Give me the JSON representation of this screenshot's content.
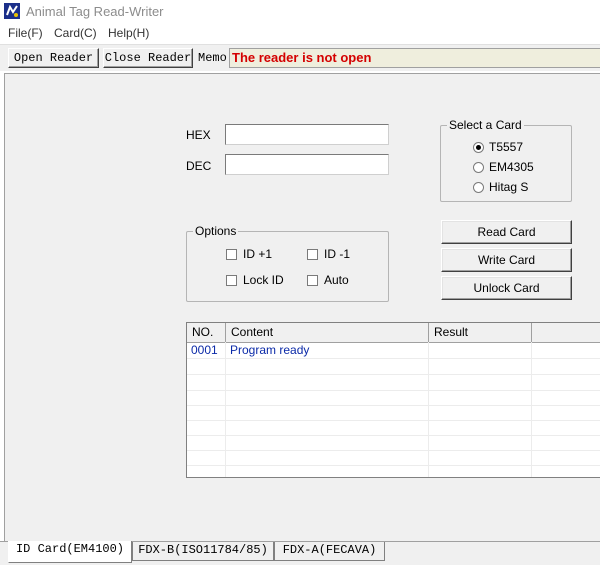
{
  "window": {
    "title": "Animal Tag Read-Writer",
    "icon": "app-icon"
  },
  "menu": [
    {
      "label": "File(F)"
    },
    {
      "label": "Card(C)"
    },
    {
      "label": "Help(H)"
    }
  ],
  "toolbar": {
    "open_label": "Open Reader",
    "close_label": "Close Reader",
    "memo_label": "Memo",
    "status_text": "The reader is not open",
    "status_color": "#d40000"
  },
  "fields": {
    "hex_label": "HEX",
    "hex_value": "",
    "dec_label": "DEC",
    "dec_value": ""
  },
  "select_card": {
    "title": "Select a Card",
    "options": [
      "T5557",
      "EM4305",
      "Hitag S"
    ],
    "selected": "T5557"
  },
  "options_group": {
    "title": "Options",
    "checks": [
      {
        "label": "ID +1",
        "checked": false
      },
      {
        "label": "ID -1",
        "checked": false
      },
      {
        "label": "Lock ID",
        "checked": false
      },
      {
        "label": "Auto",
        "checked": false
      }
    ]
  },
  "actions": {
    "read_label": "Read Card",
    "write_label": "Write Card",
    "unlock_label": "Unlock Card"
  },
  "log_table": {
    "columns": [
      "NO.",
      "Content",
      "Result"
    ],
    "rows": [
      {
        "no": "0001",
        "content": "Program ready",
        "result": ""
      }
    ],
    "text_color": "#0b2aa8"
  },
  "tabs": [
    {
      "label": "ID Card(EM4100)",
      "active": true
    },
    {
      "label": "FDX-B(ISO11784/85)",
      "active": false
    },
    {
      "label": "FDX-A(FECAVA)",
      "active": false
    }
  ]
}
